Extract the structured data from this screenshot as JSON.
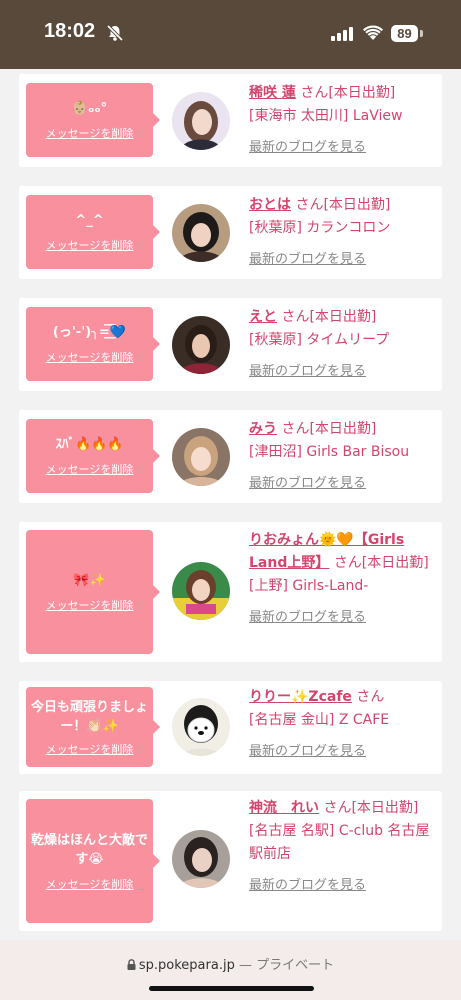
{
  "status_bar": {
    "time": "18:02",
    "battery": "89"
  },
  "delete_label": "メッセージを削除",
  "blog_label": "最新のブログを見る",
  "cards": [
    {
      "message": "👶🏼ₒₒ°",
      "name": "稀咲 蓮",
      "suffix": "さん[本日出勤]",
      "shop": "[東海市 太田川] LaView"
    },
    {
      "message": "^_^",
      "name": "おとは",
      "suffix": "さん[本日出勤]",
      "shop": "[秋葉原] カランコロン"
    },
    {
      "message": "(っ'-')╮=͟͟͞͞💙",
      "name": "えと",
      "suffix": "さん[本日出勤]",
      "shop": "[秋葉原] タイムリープ"
    },
    {
      "message": "ｽﾊﾞ🔥🔥🔥",
      "name": "みう",
      "suffix": "さん[本日出勤]",
      "shop": "[津田沼] Girls Bar Bisou"
    },
    {
      "message": "🎀✨",
      "name": "りおみょん🌞🧡【Girls Land上野】",
      "suffix": "さん[本日出勤]",
      "shop": "[上野] Girls-Land-"
    },
    {
      "message": "今日も頑張りましょー！👏🏻✨",
      "name": "りりー✨Zcafe",
      "suffix": "さん",
      "shop": "[名古屋 金山] Z CAFE"
    },
    {
      "message": "乾燥はほんと大敵です😭",
      "name": "神流　れい",
      "suffix": "さん[本日出勤]",
      "shop": "[名古屋 名駅] C-club 名古屋駅前店"
    }
  ],
  "browser": {
    "domain": "sp.pokepara.jp",
    "mode": "— プライベート"
  }
}
